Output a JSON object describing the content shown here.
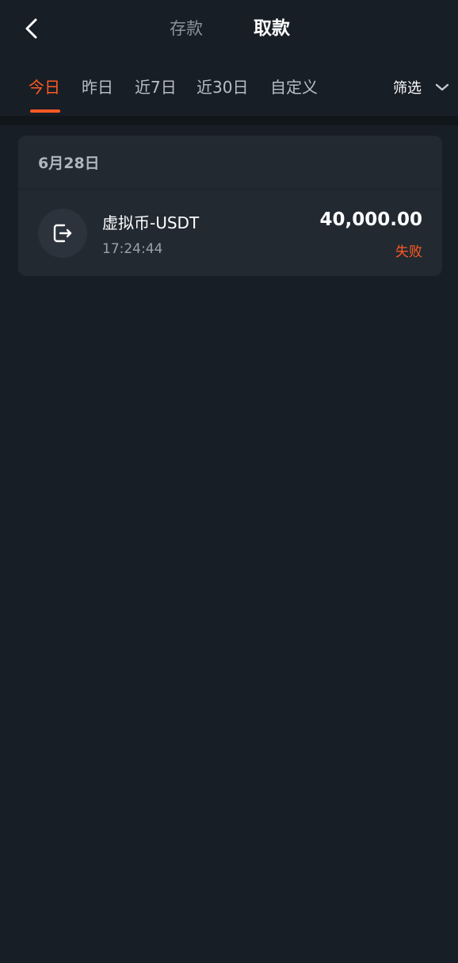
{
  "header": {
    "tabs": [
      {
        "label": "存款"
      },
      {
        "label": "取款"
      }
    ]
  },
  "filters": {
    "periods": [
      {
        "label": "今日"
      },
      {
        "label": "昨日"
      },
      {
        "label": "近7日"
      },
      {
        "label": "近30日"
      },
      {
        "label": "自定义"
      }
    ],
    "filter_label": "筛选"
  },
  "records": [
    {
      "date": "6月28日",
      "title": "虚拟币-USDT",
      "time": "17:24:44",
      "amount": "40,000.00",
      "status": "失败"
    }
  ],
  "colors": {
    "accent": "#ff5a25",
    "background": "#181e25",
    "card": "#222931"
  }
}
